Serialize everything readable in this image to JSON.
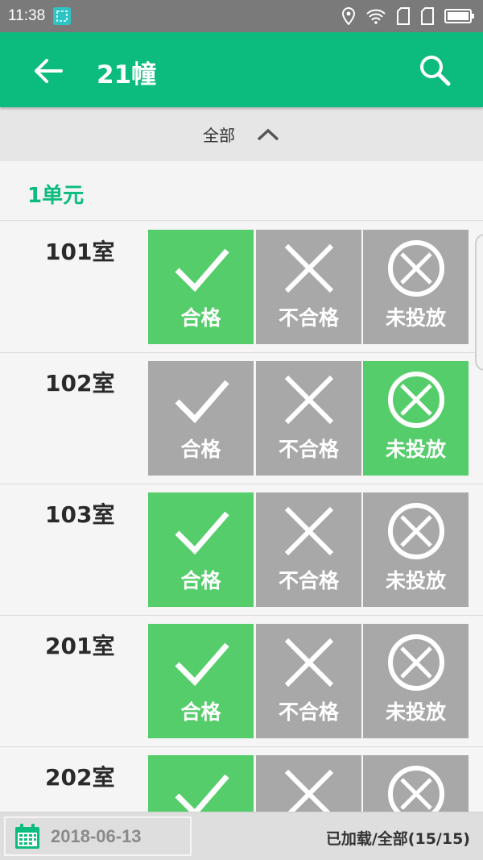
{
  "status_bar": {
    "time": "11:38"
  },
  "app_bar": {
    "title": "21幢"
  },
  "filter": {
    "label": "全部"
  },
  "unit": {
    "label": "1单元"
  },
  "options": [
    "合格",
    "不合格",
    "未投放"
  ],
  "rooms": [
    {
      "name": "101室",
      "selected": "合格"
    },
    {
      "name": "102室",
      "selected": "未投放"
    },
    {
      "name": "103室",
      "selected": "合格"
    },
    {
      "name": "201室",
      "selected": "合格"
    },
    {
      "name": "202室",
      "selected": "合格"
    }
  ],
  "footer": {
    "date": "2018-06-13",
    "loaded": "已加载/全部(15/15)"
  },
  "colors": {
    "primary": "#0bbc7e",
    "selected": "#55cd6b",
    "unselected": "#a8a8a8"
  }
}
